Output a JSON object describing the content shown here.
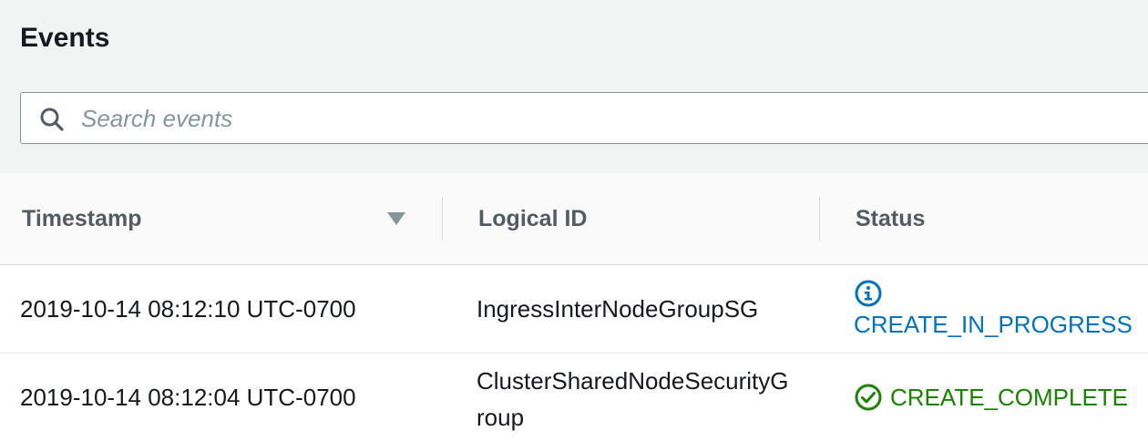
{
  "page": {
    "title": "Events"
  },
  "search": {
    "placeholder": "Search events",
    "value": ""
  },
  "table": {
    "columns": [
      "Timestamp",
      "Logical ID",
      "Status"
    ],
    "sort": {
      "column": "Timestamp",
      "direction": "descending"
    },
    "rows": [
      {
        "timestamp": "2019-10-14 08:12:10 UTC-0700",
        "logical_id": "IngressInterNodeGroupSG",
        "status": "CREATE_IN_PROGRESS",
        "status_icon": "info-icon"
      },
      {
        "timestamp": "2019-10-14 08:12:04 UTC-0700",
        "logical_id": "ClusterSharedNodeSecurityGroup",
        "status": "CREATE_COMPLETE",
        "status_icon": "check-circle-icon"
      }
    ]
  },
  "colors": {
    "in_progress": "#0073bb",
    "complete": "#1d8102",
    "header_text": "#545b64",
    "body_text": "#16191f"
  }
}
